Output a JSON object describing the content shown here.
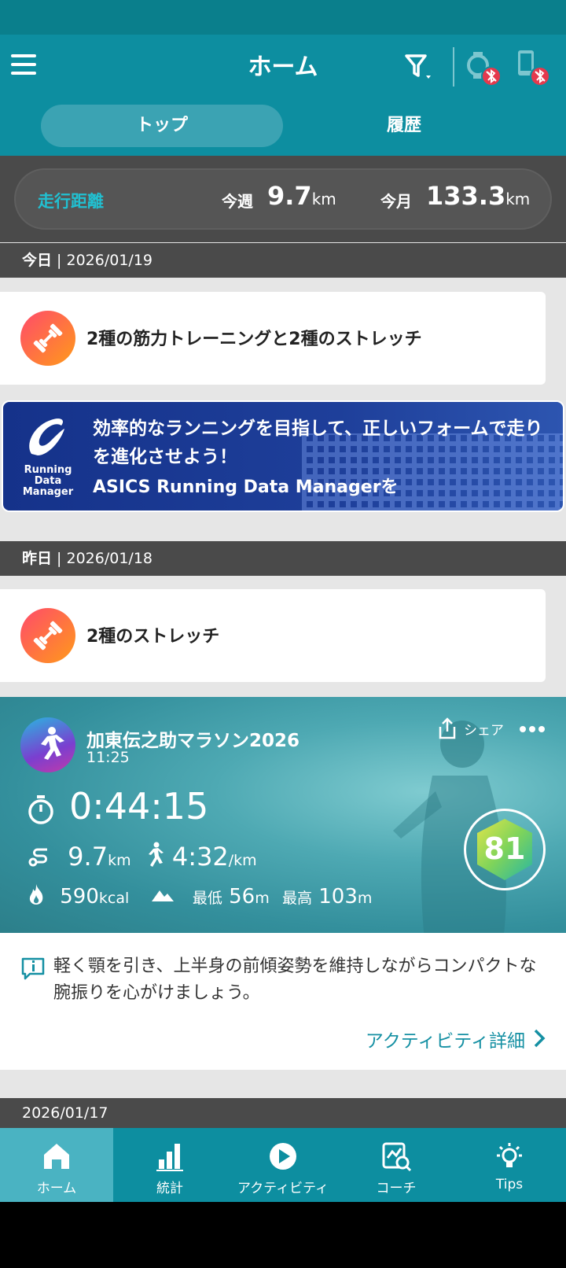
{
  "app_bar": {
    "title": "ホーム"
  },
  "tabs": [
    {
      "label": "トップ",
      "active": true
    },
    {
      "label": "履歴",
      "active": false
    }
  ],
  "distance": {
    "label": "走行距離",
    "week_label": "今週",
    "week_value": "9.7",
    "week_unit": "km",
    "month_label": "今月",
    "month_value": "133.3",
    "month_unit": "km"
  },
  "today": {
    "prefix": "今日",
    "separator": " | ",
    "date": "2026/01/19",
    "training": "2種の筋力トレーニングと2種のストレッチ"
  },
  "banner": {
    "logo_text": "Running Data Manager",
    "headline": "効率的なランニングを目指して、正しいフォームで走りを進化させよう！",
    "subline": "ASICS Running Data Managerを"
  },
  "yesterday": {
    "prefix": "昨日",
    "separator": " | ",
    "date": "2026/01/18",
    "training": "2種のストレッチ"
  },
  "activity": {
    "title": "加東伝之助マラソン2026",
    "time": "11:25",
    "share_label": "シェア",
    "duration": "0:44:15",
    "distance": "9.7",
    "distance_unit": "km",
    "pace": "4:32",
    "pace_unit": "/km",
    "calories": "590",
    "calories_unit": "kcal",
    "min_label": "最低",
    "min_elev": "56",
    "min_unit": "m",
    "max_label": "最高",
    "max_elev": "103",
    "max_unit": "m",
    "score": "81"
  },
  "advice": {
    "text": "軽く顎を引き、上半身の前傾姿勢を維持しながらコンパクトな腕振りを心がけましょう。",
    "link": "アクティビティ詳細"
  },
  "next_date": "2026/01/17",
  "bottom_nav": [
    {
      "label": "ホーム",
      "icon": "home-icon",
      "active": true
    },
    {
      "label": "統計",
      "icon": "stats-icon",
      "active": false
    },
    {
      "label": "アクティビティ",
      "icon": "play-icon",
      "active": false
    },
    {
      "label": "コーチ",
      "icon": "coach-icon",
      "active": false
    },
    {
      "label": "Tips",
      "icon": "bulb-icon",
      "active": false
    }
  ],
  "colors": {
    "primary": "#0d8ea0",
    "accent": "#21c0d1",
    "alert": "#e5394d"
  }
}
